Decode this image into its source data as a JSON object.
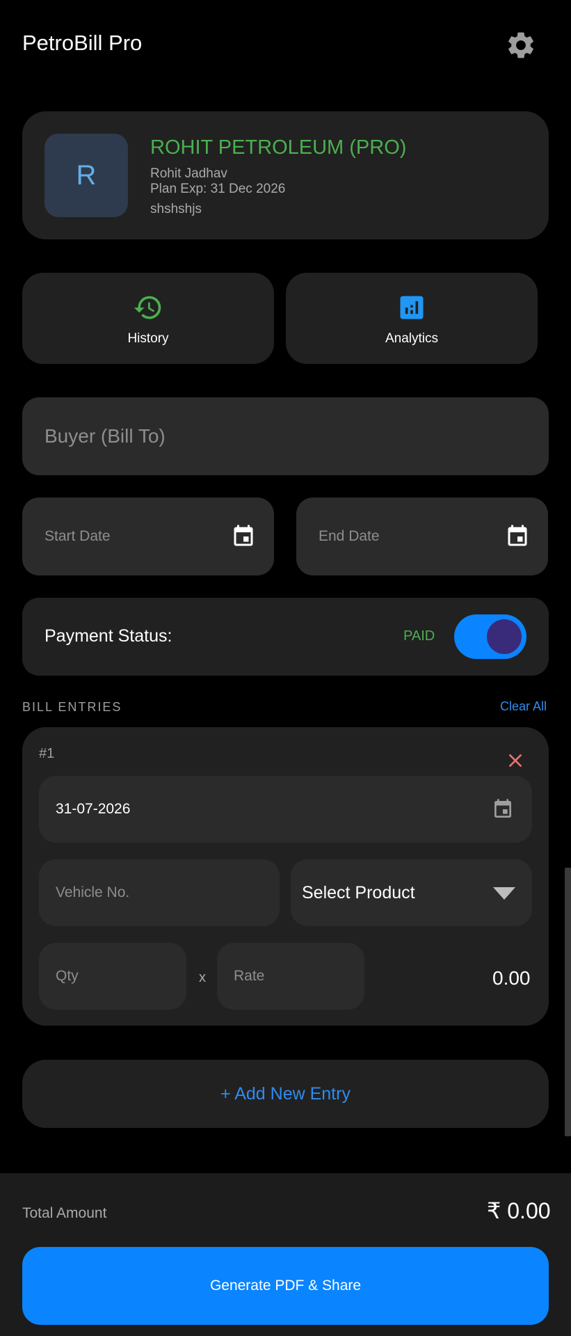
{
  "header": {
    "title": "PetroBill Pro",
    "settings_icon": "gear-icon"
  },
  "profile": {
    "avatar_letter": "R",
    "business_name": "ROHIT PETROLEUM (PRO)",
    "owner": "Rohit Jadhav",
    "plan_expiry": "Plan Exp: 31 Dec 2026",
    "extra": "shshshjs"
  },
  "quick_actions": {
    "history": {
      "label": "History",
      "icon": "history-icon"
    },
    "analytics": {
      "label": "Analytics",
      "icon": "analytics-icon"
    }
  },
  "buyer": {
    "placeholder": "Buyer (Bill To)",
    "value": ""
  },
  "dates": {
    "start_placeholder": "Start Date",
    "end_placeholder": "End Date"
  },
  "payment": {
    "label": "Payment Status:",
    "status": "PAID",
    "toggle_on": true
  },
  "entries_section": {
    "title": "BILL ENTRIES",
    "clear_label": "Clear All"
  },
  "entries": [
    {
      "number": "#1",
      "date": "31-07-2026",
      "vehicle_placeholder": "Vehicle No.",
      "product": "Select Product",
      "qty_placeholder": "Qty",
      "times": "x",
      "rate_placeholder": "Rate",
      "total": "0.00"
    }
  ],
  "add_entry_label": "+ Add New Entry",
  "footer": {
    "total_label": "Total Amount",
    "total_value": "₹ 0.00",
    "generate_label": "Generate PDF & Share"
  },
  "colors": {
    "accent_blue": "#0a84ff",
    "success_green": "#4caf50",
    "danger_red": "#e57373",
    "background": "#000000",
    "card": "#212121"
  }
}
